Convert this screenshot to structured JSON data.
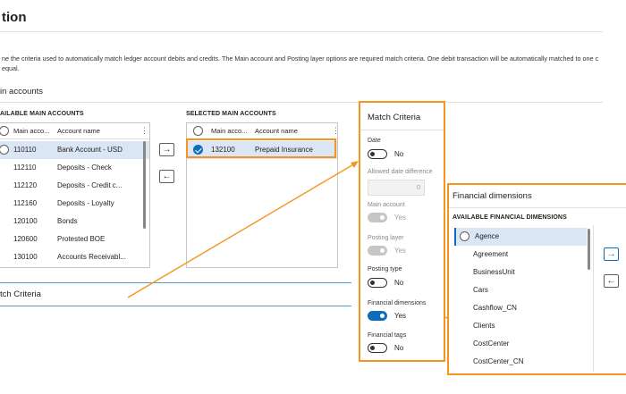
{
  "page": {
    "title": "tion",
    "description": "ne the criteria used to automatically match ledger account debits and credits. The Main account and Posting layer options are required match criteria. One debit transaction will be automatically matched to one c equal."
  },
  "main_accounts": {
    "section_title": "in accounts",
    "available_label": "AILABLE MAIN ACCOUNTS",
    "selected_label": "SELECTED MAIN ACCOUNTS",
    "col_main_account": "Main acco...",
    "col_account_name": "Account name",
    "more_glyph": "⋮",
    "available_rows": [
      {
        "account": "110110",
        "name": "Bank Account - USD"
      },
      {
        "account": "112110",
        "name": "Deposits - Check"
      },
      {
        "account": "112120",
        "name": "Deposits - Credit c..."
      },
      {
        "account": "112160",
        "name": "Deposits - Loyalty"
      },
      {
        "account": "120100",
        "name": "Bonds"
      },
      {
        "account": "120600",
        "name": "Protested BOE"
      },
      {
        "account": "130100",
        "name": "Accounts Receivabl..."
      }
    ],
    "selected_rows": [
      {
        "account": "132100",
        "name": "Prepaid Insurance"
      }
    ],
    "add_glyph": "→",
    "remove_glyph": "←"
  },
  "match_criteria_section": {
    "title": "tch Criteria"
  },
  "match_criteria_panel": {
    "title": "Match Criteria",
    "fields": {
      "date": {
        "label": "Date",
        "value": "No"
      },
      "allowed_date_difference": {
        "label": "Allowed date difference",
        "value": "0"
      },
      "main_account": {
        "label": "Main account",
        "value": "Yes"
      },
      "posting_layer": {
        "label": "Posting layer",
        "value": "Yes"
      },
      "posting_type": {
        "label": "Posting type",
        "value": "No"
      },
      "financial_dimensions": {
        "label": "Financial dimensions",
        "value": "Yes"
      },
      "financial_tags": {
        "label": "Financial tags",
        "value": "No"
      }
    }
  },
  "financial_dimensions_panel": {
    "title": "Financial dimensions",
    "available_label": "AVAILABLE FINANCIAL DIMENSIONS",
    "items": [
      "Agence",
      "Agreement",
      "BusinessUnit",
      "Cars",
      "Cashflow_CN",
      "Clients",
      "CostCenter",
      "CostCenter_CN"
    ],
    "add_glyph": "→",
    "remove_glyph": "←"
  },
  "colors": {
    "accent": "#0f6cbd",
    "highlight": "#f7941d",
    "selected_row": "#dbe6f4"
  }
}
